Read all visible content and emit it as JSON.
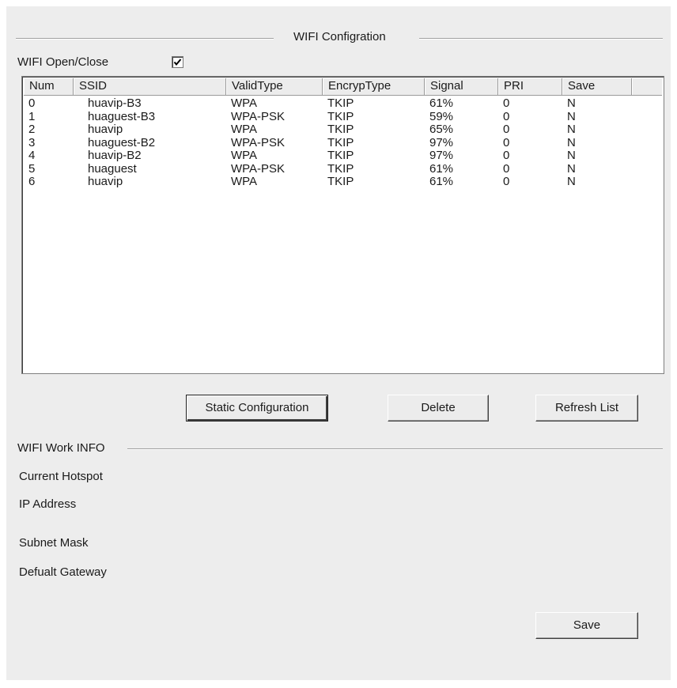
{
  "wifi_config": {
    "group_title": "WIFI Configration",
    "open_close_label": "WIFI Open/Close",
    "open_close_checked": true
  },
  "hotspot_list": {
    "columns": [
      "Num",
      "SSID",
      "ValidType",
      "EncrypType",
      "Signal",
      "PRI",
      "Save"
    ],
    "rows": [
      [
        "0",
        "huavip-B3",
        "WPA",
        "TKIP",
        "61%",
        "0",
        "N"
      ],
      [
        "1",
        "huaguest-B3",
        "WPA-PSK",
        "TKIP",
        "59%",
        "0",
        "N"
      ],
      [
        "2",
        "huavip",
        "WPA",
        "TKIP",
        "65%",
        "0",
        "N"
      ],
      [
        "3",
        "huaguest-B2",
        "WPA-PSK",
        "TKIP",
        "97%",
        "0",
        "N"
      ],
      [
        "4",
        "huavip-B2",
        "WPA",
        "TKIP",
        "97%",
        "0",
        "N"
      ],
      [
        "5",
        "huaguest",
        "WPA-PSK",
        "TKIP",
        "61%",
        "0",
        "N"
      ],
      [
        "6",
        "huavip",
        "WPA",
        "TKIP",
        "61%",
        "0",
        "N"
      ]
    ]
  },
  "actions": {
    "static_config_label": "Static Configuration",
    "delete_label": "Delete",
    "refresh_label": "Refresh List"
  },
  "work_info": {
    "group_title": "WIFI Work INFO",
    "current_hotspot_label": "Current Hotspot",
    "ip_address_label": "IP Address",
    "subnet_mask_label": "Subnet Mask",
    "default_gateway_label": "Defualt Gateway"
  },
  "footer": {
    "save_label": "Save"
  }
}
